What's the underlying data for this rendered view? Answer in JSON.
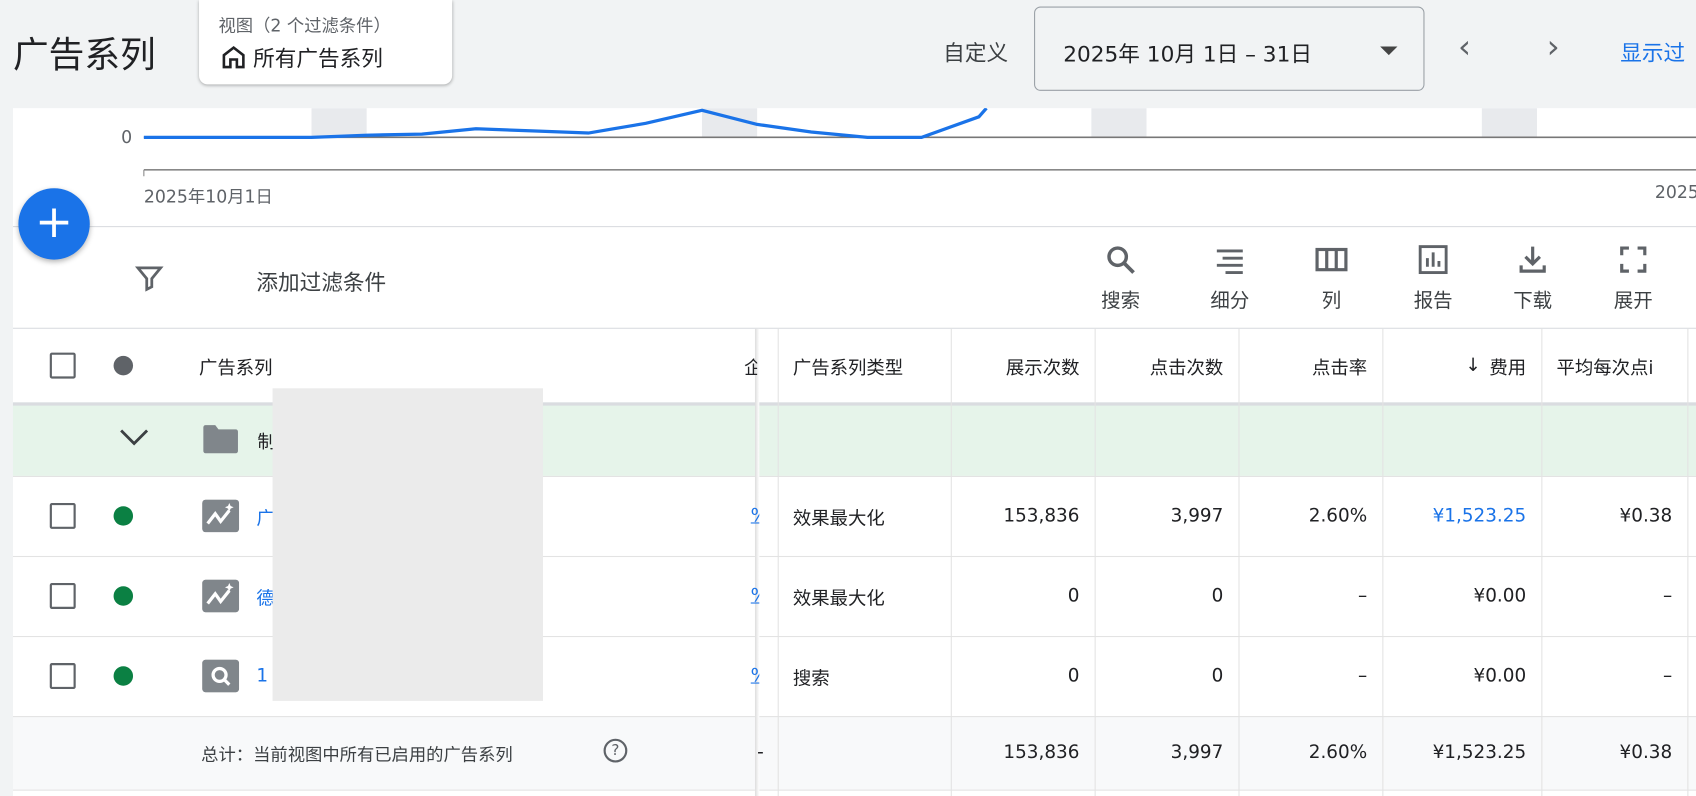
{
  "header": {
    "title": "广告系列",
    "view_subtitle": "视图（2 个过滤条件）",
    "view_name": "所有广告系列",
    "custom_label": "自定义",
    "date_range": "2025年 10月 1日 – 31日",
    "show_label": "显示过"
  },
  "chart": {
    "y_zero": "0",
    "x_start": "2025年10月1日",
    "x_end_partial": "2025"
  },
  "filter": {
    "add_filter": "添加过滤条件"
  },
  "toolbar": {
    "search": "搜索",
    "segment": "细分",
    "columns": "列",
    "reports": "报告",
    "download": "下载",
    "expand": "展开"
  },
  "table": {
    "headers": {
      "campaign": "广告系列",
      "clipped": "企",
      "type": "广告系列类型",
      "impr": "展示次数",
      "clicks": "点击次数",
      "ctr": "点击率",
      "cost": "费用",
      "avg_cpc": "平均每次点i"
    },
    "group": {
      "name": "制"
    },
    "rows": [
      {
        "name": "广",
        "pct": "%",
        "type": "效果最大化",
        "impr": "153,836",
        "clicks": "3,997",
        "ctr": "2.60%",
        "cost": "¥1,523.25",
        "avg_cpc": "¥0.38",
        "status_color": "#0b8043"
      },
      {
        "name": "德",
        "pct": "%",
        "type": "效果最大化",
        "impr": "0",
        "clicks": "0",
        "ctr": "–",
        "cost": "¥0.00",
        "avg_cpc": "–",
        "status_color": "#0b8043"
      },
      {
        "name": "1",
        "pct": "%",
        "type": "搜索",
        "impr": "0",
        "clicks": "0",
        "ctr": "–",
        "cost": "¥0.00",
        "avg_cpc": "–",
        "status_color": "#0b8043"
      }
    ],
    "total": {
      "label": "总计：当前视图中所有已启用的广告系列",
      "clipped": "-",
      "impr": "153,836",
      "clicks": "3,997",
      "ctr": "2.60%",
      "cost": "¥1,523.25",
      "avg_cpc": "¥0.38"
    }
  },
  "colors": {
    "accent": "#1a73e8",
    "enabled": "#0b8043",
    "group_bg": "#e6f4ea"
  }
}
